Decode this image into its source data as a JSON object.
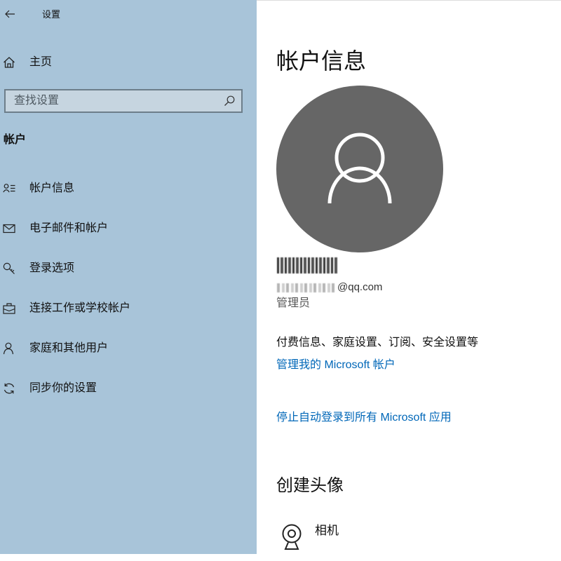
{
  "window": {
    "title": "设置",
    "back_icon": "back-arrow-icon"
  },
  "sidebar": {
    "home": {
      "label": "主页",
      "icon": "home-icon"
    },
    "search": {
      "placeholder": "查找设置",
      "icon": "search-icon"
    },
    "section_title": "帐户",
    "items": [
      {
        "label": "帐户信息",
        "icon": "account-info-icon"
      },
      {
        "label": "电子邮件和帐户",
        "icon": "mail-icon"
      },
      {
        "label": "登录选项",
        "icon": "key-icon"
      },
      {
        "label": "连接工作或学校帐户",
        "icon": "briefcase-icon"
      },
      {
        "label": "家庭和其他用户",
        "icon": "person-icon"
      },
      {
        "label": "同步你的设置",
        "icon": "sync-icon"
      }
    ]
  },
  "main": {
    "title": "帐户信息",
    "avatar_icon": "user-avatar-icon",
    "email_suffix": "@qq.com",
    "role": "管理员",
    "description": "付费信息、家庭设置、订阅、安全设置等",
    "manage_link": "管理我的 Microsoft 帐户",
    "stop_autologin_link": "停止自动登录到所有 Microsoft 应用",
    "create_avatar": {
      "title": "创建头像",
      "camera": {
        "label": "相机",
        "icon": "camera-icon"
      }
    }
  },
  "colors": {
    "sidebar_bg": "#a8c4d9",
    "link": "#0067b8",
    "avatar_bg": "#666666"
  }
}
